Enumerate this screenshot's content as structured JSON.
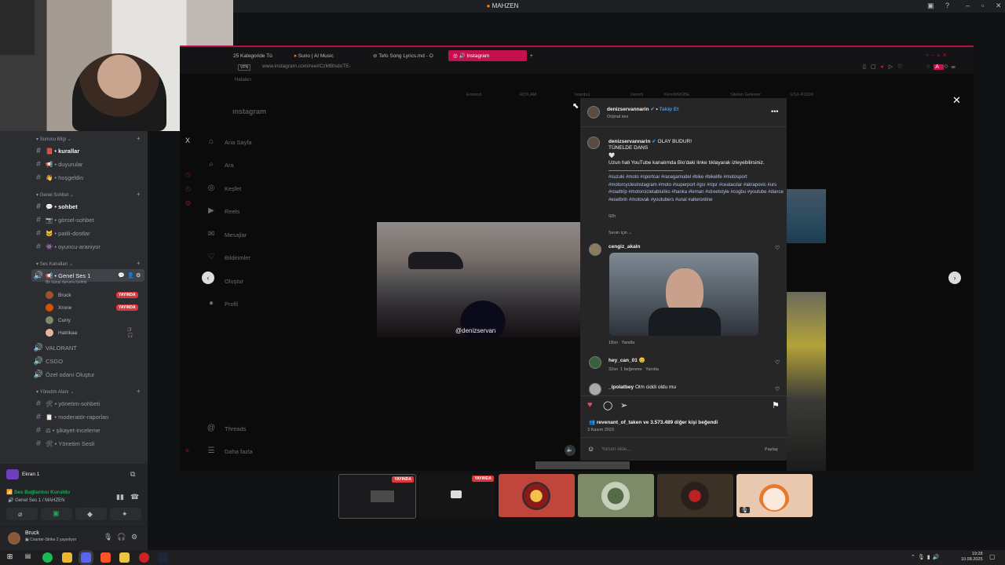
{
  "window": {
    "title": "MAHZEN"
  },
  "sidebar": {
    "categories": [
      {
        "label": "Sunucu Bilgi"
      },
      {
        "label": "Genel Sohbet"
      },
      {
        "label": "Ses Kanalları"
      },
      {
        "label": "Yönetim Alanı"
      }
    ],
    "text_channels": [
      {
        "label": "kurallar",
        "emoji": "📕",
        "bold": true
      },
      {
        "label": "duyurular",
        "emoji": "📢",
        "bold": false
      },
      {
        "label": "hoşgeldin",
        "emoji": "👋",
        "bold": false
      },
      {
        "label": "sohbet",
        "emoji": "💬",
        "bold": true
      },
      {
        "label": "görsel-sohbet",
        "emoji": "📷",
        "bold": false
      },
      {
        "label": "patili-dostlar",
        "emoji": "🐱",
        "bold": false
      },
      {
        "label": "oyuncu-araniyor",
        "emoji": "👾",
        "bold": false
      }
    ],
    "voice": {
      "active_channel": "Genel Ses 1",
      "activity": "Bir kanal durumu belirle",
      "users": [
        {
          "name": "Bruck",
          "live": true
        },
        {
          "name": "Xrone",
          "live": true
        },
        {
          "name": "Curry",
          "live": false
        },
        {
          "name": "Hatrikaa",
          "live": false
        }
      ],
      "live_label": "YAYINDA",
      "other_channels": [
        "VALORANT",
        "CSGO",
        "Özel odanı Oluştur"
      ]
    },
    "admin_channels": [
      {
        "label": "yönetim-sohbeti",
        "emoji": "🛠"
      },
      {
        "label": "moderatör-raporları",
        "emoji": "📋"
      },
      {
        "label": "şikayet-inceleme",
        "emoji": "⚖"
      },
      {
        "label": "Yönetim Sesli",
        "emoji": "🛠"
      }
    ]
  },
  "screen_panel": {
    "label": "Ekran 1",
    "connection_status": "Ses Bağlantısı Kuruldu",
    "connection_detail": "Genel Ses 1 / MAHZEN"
  },
  "user_panel": {
    "name": "Bruck",
    "status": "Counter-Strike 2 yayınlıyor"
  },
  "browser": {
    "tabs": [
      {
        "label": "25 Kategoride Tü"
      },
      {
        "label": "Suno | AI Music"
      },
      {
        "label": "Tefo Song Lyrics.md - O"
      },
      {
        "label": "Instagram",
        "active": true
      }
    ],
    "url": "www.instagram.com/reel/CzMBlsdoTE-",
    "vpn": "VPN",
    "bookmark": "Hataları"
  },
  "instagram": {
    "logo": "ınstagram",
    "close": "X",
    "nav": [
      "Ana Sayfa",
      "Ara",
      "Keşfet",
      "Reels",
      "Mesajlar",
      "Bildirimler",
      "Oluştur",
      "Profil",
      "Threads",
      "Daha fazla"
    ],
    "top_links": [
      "Eromod",
      "RDX.AM",
      "İstanbul",
      "Denizli",
      "Kereb/MOBE",
      "Sitelan Gelenler",
      "GSX-R1000"
    ],
    "video_watermark": "@denizservan",
    "post": {
      "author": "denizservannarin",
      "follow": "Takip Et",
      "audio": "Orijinal ses",
      "caption_title": "OLAY BUDUR!",
      "caption_line2": "TÜNELDE DANS",
      "caption_body": "Uzun hali YouTube kanalımda Bio'daki linke tıklayarak izleyebilirsiniz.",
      "hashtags": "#suzuki #moto #sportcar #racegamodel #bike #bikelife #motosport #motorcyclesinstagram #moto #superport #gsr #rqsr #ceatacılar #akrapovic #urs #roadtrip #motorcicletabluriko #hanka #leman #streetstyle #cogbu #youtube #dance #eselbrin #motovak #youtubers #unal #alteronline",
      "caption_age": "92h",
      "translation": "Senin için",
      "comments": [
        {
          "user": "cengiz_akaln",
          "text": "",
          "age": "18sn",
          "reply": "Yanıtla"
        },
        {
          "user": "hey_can_01",
          "text": "😊",
          "age": "32sn",
          "likes": "1 beğenme",
          "reply": "Yanıtla"
        },
        {
          "user": "_ipolatbey",
          "text": "Olm ciddi oldu mu"
        }
      ],
      "liked_by_user": "revenant_of_taken",
      "liked_by_suffix": "ve 3.573.489 diğer kişi beğendi",
      "date": "3 Kasım 2023",
      "comment_placeholder": "Yorum ekle...",
      "share": "Paylaş"
    }
  },
  "thumbnails": [
    {
      "live": true,
      "live_label": "YAYINDA"
    },
    {
      "live": true,
      "live_label": "YAYINDA"
    },
    {
      "live": false
    },
    {
      "live": false
    },
    {
      "live": false
    },
    {
      "live": false
    }
  ],
  "taskbar": {
    "time": "19:28",
    "date": "10.08.2025"
  },
  "colors": {
    "discord_bg": "#2b2d31",
    "live_red": "#da373c",
    "brave_accent": "#c4114d",
    "instagram_like": "#ed4956",
    "connected_green": "#23a55a"
  }
}
